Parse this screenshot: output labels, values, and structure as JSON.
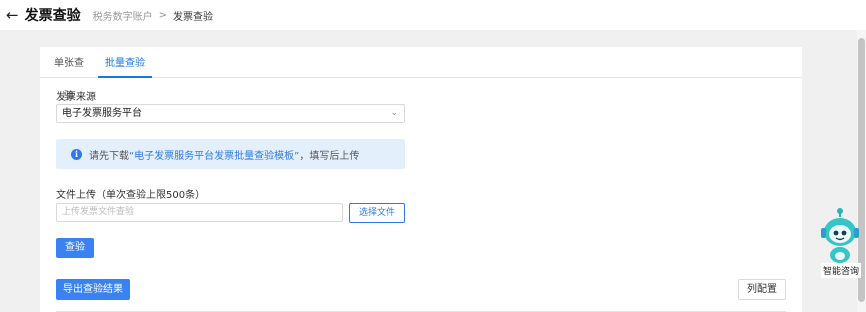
{
  "header": {
    "back_icon": "arrow-left-icon",
    "title": "发票查验",
    "breadcrumb": [
      "税务数字账户",
      "发票查验"
    ],
    "breadcrumb_separator": ">"
  },
  "tabs": [
    {
      "label": "单张查验",
      "active": false
    },
    {
      "label": "批量查验",
      "active": true
    }
  ],
  "form": {
    "source_label": "发票来源",
    "source_value": "电子发票服务平台",
    "info_prefix": "请先下载",
    "info_link": "“电子发票服务平台发票批量查验模板”",
    "info_suffix": "，填写后上传",
    "upload_label": "文件上传（单次查验上限500条）",
    "upload_placeholder": "上传发票文件查验",
    "choose_file_label": "选择文件",
    "verify_label": "查验"
  },
  "actions": {
    "export_label": "导出查验结果",
    "column_config_label": "列配置"
  },
  "assistant": {
    "label": "智能咨询"
  },
  "colors": {
    "accent": "#2d7ae6",
    "primary_button": "#3a82f0",
    "info_background": "#e4effc",
    "page_background": "#f0f0f0"
  }
}
